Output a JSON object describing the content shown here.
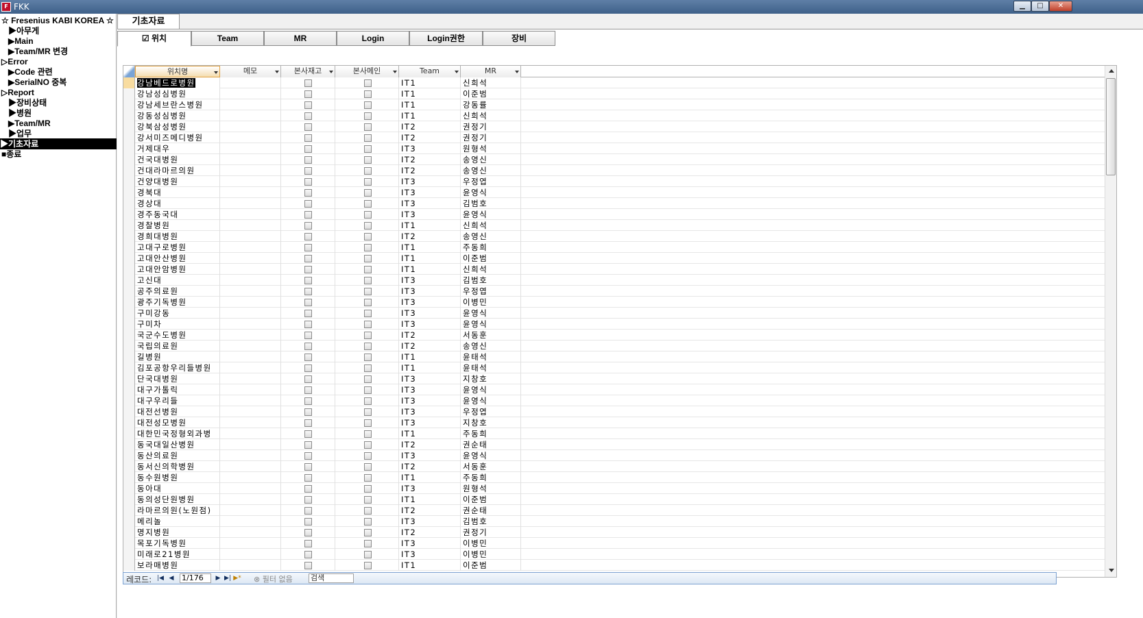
{
  "window": {
    "title": "FKK",
    "icon": "app-logo-icon",
    "controls": [
      "minimize-icon",
      "maximize-icon",
      "close-icon"
    ]
  },
  "sidebar": {
    "header": "☆ Fresenius KABI KOREA ☆",
    "items": [
      {
        "label": "▶아무게",
        "indent": 1
      },
      {
        "label": "▶Main",
        "indent": 1
      },
      {
        "label": "▶Team/MR 변경",
        "indent": 1
      },
      {
        "label": "▷Error",
        "indent": 0
      },
      {
        "label": "▶Code 관련",
        "indent": 1
      },
      {
        "label": "▶SerialNO 중복",
        "indent": 1
      },
      {
        "label": "▷Report",
        "indent": 0
      },
      {
        "label": "▶장비상태",
        "indent": 1
      },
      {
        "label": "▶병원",
        "indent": 1
      },
      {
        "label": "▶Team/MR",
        "indent": 1
      },
      {
        "label": "▶업무",
        "indent": 1
      },
      {
        "label": "▶기초자료",
        "indent": 0,
        "active": true
      },
      {
        "label": "■종료",
        "indent": 0
      }
    ]
  },
  "document_tab": "기초자료",
  "tabs": [
    {
      "label": "위치",
      "icon": "form-checkbox-icon",
      "selected": true
    },
    {
      "label": "Team"
    },
    {
      "label": "MR"
    },
    {
      "label": "Login"
    },
    {
      "label": "Login권한"
    },
    {
      "label": "장비"
    }
  ],
  "grid": {
    "columns": [
      "위치명",
      "메모",
      "본사재고",
      "본사메인",
      "Team",
      "MR"
    ],
    "rows": [
      [
        "강남베드로병원",
        "",
        false,
        false,
        "IT1",
        "신희석"
      ],
      [
        "강남성심병원",
        "",
        false,
        false,
        "IT1",
        "이준범"
      ],
      [
        "강남세브란스병원",
        "",
        false,
        false,
        "IT1",
        "강동률"
      ],
      [
        "강동성심병원",
        "",
        false,
        false,
        "IT1",
        "신희석"
      ],
      [
        "강북삼성병원",
        "",
        false,
        false,
        "IT2",
        "권정기"
      ],
      [
        "강서미즈메디병원",
        "",
        false,
        false,
        "IT2",
        "권정기"
      ],
      [
        "거제대우",
        "",
        false,
        false,
        "IT3",
        "원형석"
      ],
      [
        "건국대병원",
        "",
        false,
        false,
        "IT2",
        "송영신"
      ],
      [
        "건대라마르의원",
        "",
        false,
        false,
        "IT2",
        "송영신"
      ],
      [
        "건양대병원",
        "",
        false,
        false,
        "IT3",
        "우정엽"
      ],
      [
        "경북대",
        "",
        false,
        false,
        "IT3",
        "윤영식"
      ],
      [
        "경상대",
        "",
        false,
        false,
        "IT3",
        "김범호"
      ],
      [
        "경주동국대",
        "",
        false,
        false,
        "IT3",
        "윤영식"
      ],
      [
        "경찰병원",
        "",
        false,
        false,
        "IT1",
        "신희석"
      ],
      [
        "경희대병원",
        "",
        false,
        false,
        "IT2",
        "송영신"
      ],
      [
        "고대구로병원",
        "",
        false,
        false,
        "IT1",
        "주동희"
      ],
      [
        "고대안산병원",
        "",
        false,
        false,
        "IT1",
        "이준범"
      ],
      [
        "고대안암병원",
        "",
        false,
        false,
        "IT1",
        "신희석"
      ],
      [
        "고신대",
        "",
        false,
        false,
        "IT3",
        "김범호"
      ],
      [
        "공주의료원",
        "",
        false,
        false,
        "IT3",
        "우정엽"
      ],
      [
        "광주기독병원",
        "",
        false,
        false,
        "IT3",
        "이병민"
      ],
      [
        "구미강동",
        "",
        false,
        false,
        "IT3",
        "윤영식"
      ],
      [
        "구미차",
        "",
        false,
        false,
        "IT3",
        "윤영식"
      ],
      [
        "국군수도병원",
        "",
        false,
        false,
        "IT2",
        "서동훈"
      ],
      [
        "국립의료원",
        "",
        false,
        false,
        "IT2",
        "송영신"
      ],
      [
        "길병원",
        "",
        false,
        false,
        "IT1",
        "윤태석"
      ],
      [
        "김포공항우리들병원",
        "",
        false,
        false,
        "IT1",
        "윤태석"
      ],
      [
        "단국대병원",
        "",
        false,
        false,
        "IT3",
        "지창호"
      ],
      [
        "대구가톨릭",
        "",
        false,
        false,
        "IT3",
        "윤영식"
      ],
      [
        "대구우리들",
        "",
        false,
        false,
        "IT3",
        "윤영식"
      ],
      [
        "대전선병원",
        "",
        false,
        false,
        "IT3",
        "우정엽"
      ],
      [
        "대전성모병원",
        "",
        false,
        false,
        "IT3",
        "지창호"
      ],
      [
        "대한민국정형외과병",
        "",
        false,
        false,
        "IT1",
        "주동희"
      ],
      [
        "동국대일산병원",
        "",
        false,
        false,
        "IT2",
        "권순태"
      ],
      [
        "동산의료원",
        "",
        false,
        false,
        "IT3",
        "윤영식"
      ],
      [
        "동서신의학병원",
        "",
        false,
        false,
        "IT2",
        "서동훈"
      ],
      [
        "동수원병원",
        "",
        false,
        false,
        "IT1",
        "주동희"
      ],
      [
        "동아대",
        "",
        false,
        false,
        "IT3",
        "원형석"
      ],
      [
        "동의성단원병원",
        "",
        false,
        false,
        "IT1",
        "이준범"
      ],
      [
        "라마르의원(노원점)",
        "",
        false,
        false,
        "IT2",
        "권순태"
      ],
      [
        "메리놀",
        "",
        false,
        false,
        "IT3",
        "김범호"
      ],
      [
        "명지병원",
        "",
        false,
        false,
        "IT2",
        "권정기"
      ],
      [
        "목포기독병원",
        "",
        false,
        false,
        "IT3",
        "이병민"
      ],
      [
        "미래로21병원",
        "",
        false,
        false,
        "IT3",
        "이병민"
      ],
      [
        "보라매병원",
        "",
        false,
        false,
        "IT1",
        "이준범"
      ]
    ]
  },
  "navbar": {
    "record_label": "레코드:",
    "record_value": "1/176",
    "filter_label": "필터 없음",
    "search_label": "검색",
    "icons": [
      "first-record-icon",
      "prev-record-icon",
      "next-record-icon",
      "last-record-icon",
      "new-record-icon",
      "filter-icon"
    ]
  }
}
